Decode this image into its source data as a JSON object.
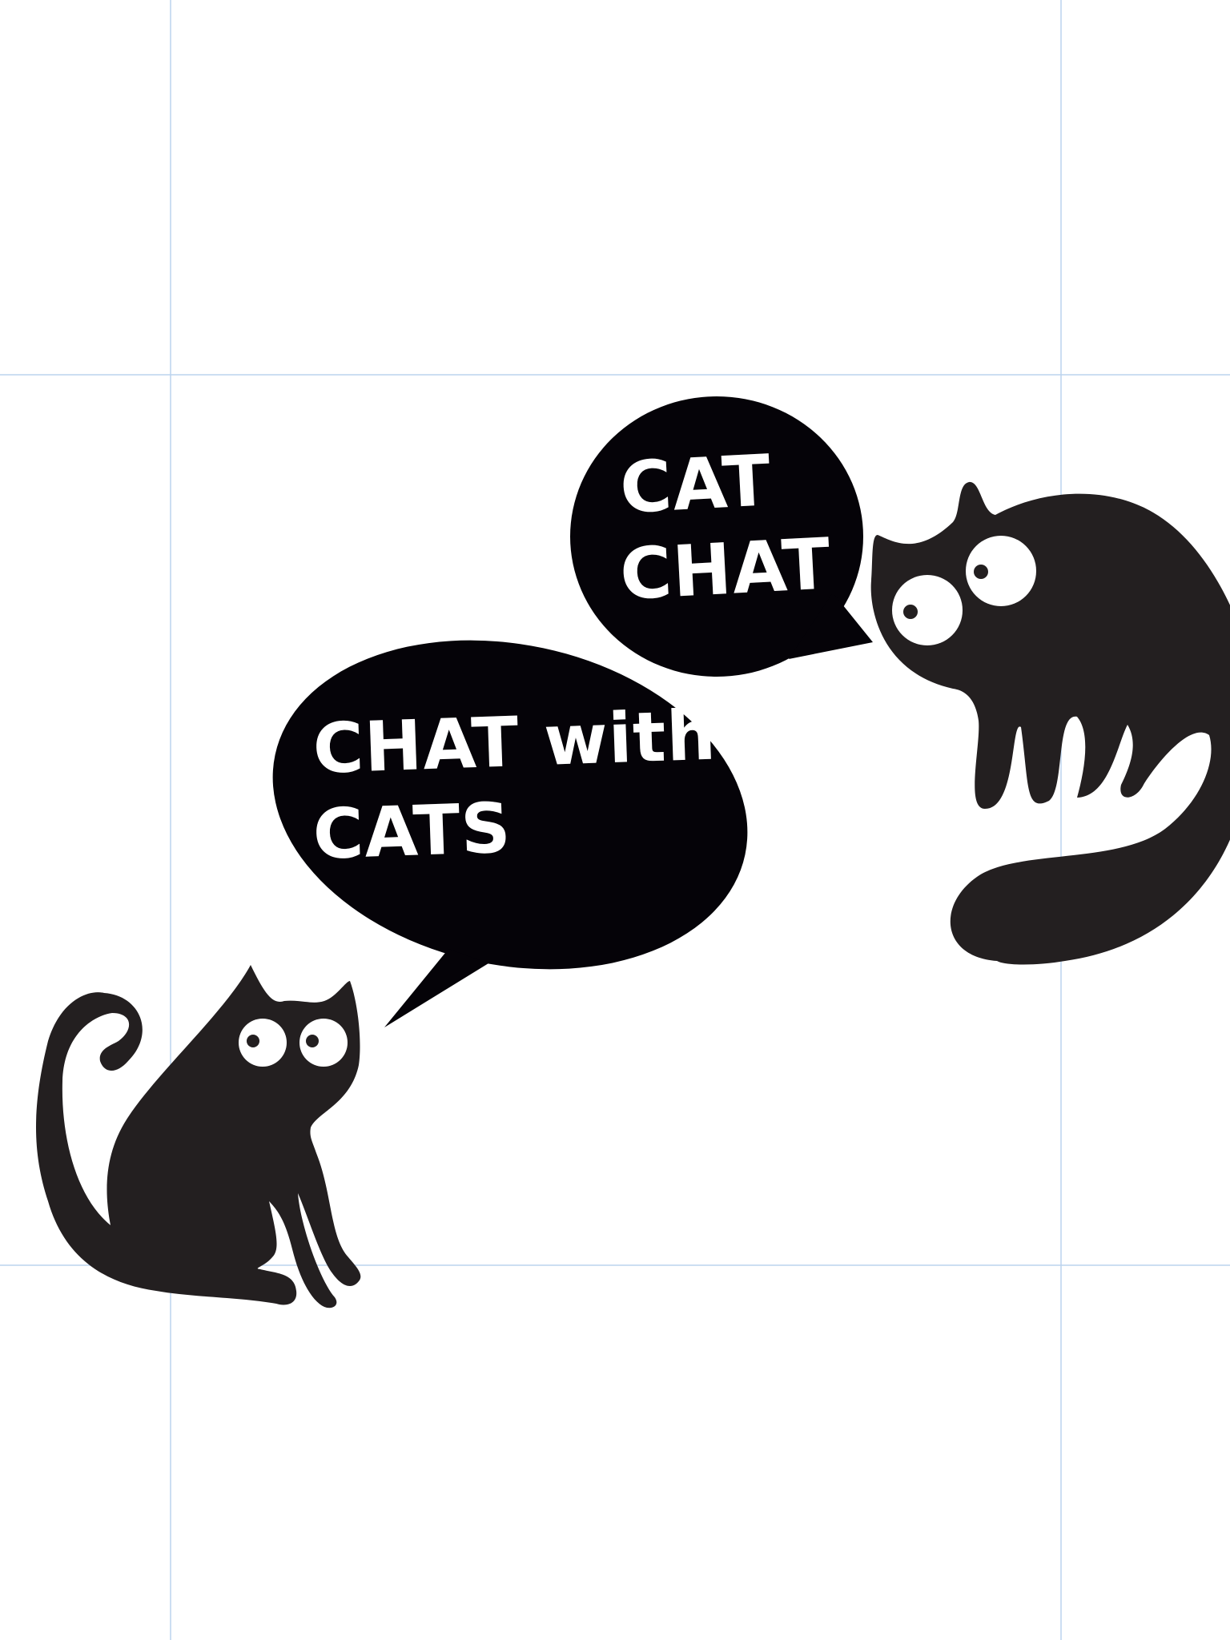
{
  "colors": {
    "background": "#ffffff",
    "ink": "#231f20",
    "bubble": "#050308",
    "eye": "#ffffff",
    "guide": "#bcd4ee"
  },
  "bubble_top": {
    "line1": "CAT",
    "line2": "CHAT"
  },
  "bubble_left": {
    "line1": "CHAT with",
    "line2": "CATS"
  }
}
